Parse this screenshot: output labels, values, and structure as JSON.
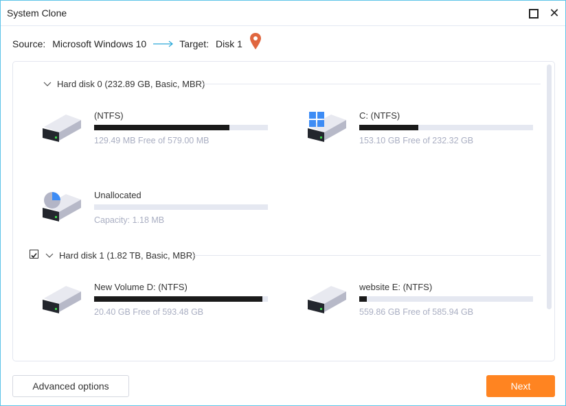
{
  "window": {
    "title": "System Clone"
  },
  "clone_summary": {
    "source_label": "Source:",
    "source_value": "Microsoft Windows 10",
    "target_label": "Target:",
    "target_value": "Disk 1"
  },
  "disks": [
    {
      "header": "Hard disk 0 (232.89 GB, Basic, MBR)",
      "checked": false,
      "partitions": [
        {
          "name": " (NTFS)",
          "info": "129.49 MB Free of 579.00 MB",
          "used_fraction": 0.78,
          "icon": "drive-icon"
        },
        {
          "name": "C: (NTFS)",
          "info": "153.10 GB Free of 232.32 GB",
          "used_fraction": 0.34,
          "icon": "windows-drive-icon"
        },
        {
          "name": "Unallocated",
          "info": "Capacity: 1.18 MB",
          "used_fraction": 0,
          "icon": "unallocated-drive-icon"
        }
      ]
    },
    {
      "header": "Hard disk 1 (1.82 TB, Basic, MBR)",
      "checked": true,
      "partitions": [
        {
          "name": "New Volume D: (NTFS)",
          "info": "20.40 GB Free of 593.48 GB",
          "used_fraction": 0.97,
          "icon": "drive-icon"
        },
        {
          "name": "website E: (NTFS)",
          "info": "559.86 GB Free of 585.94 GB",
          "used_fraction": 0.045,
          "icon": "drive-icon"
        }
      ]
    }
  ],
  "buttons": {
    "advanced": "Advanced options",
    "next": "Next"
  },
  "colors": {
    "accent": "#ff8421",
    "pin": "#e0663f",
    "windows_blue": "#3d8cf5",
    "bar_fill": "#1a1a1a",
    "bar_track": "#e5e8f1"
  }
}
